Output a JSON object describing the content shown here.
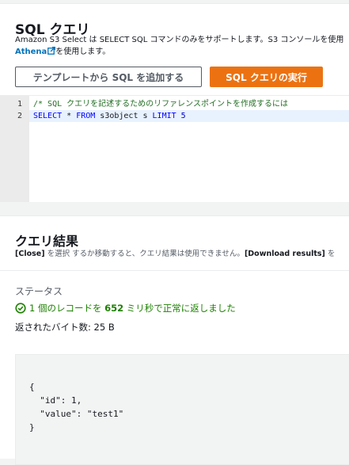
{
  "sql_panel": {
    "title": "SQL クエリ",
    "description_line1": "Amazon S3 Select は SELECT SQL コマンドのみをサポートします。S3 コンソールを使用",
    "athena_link": "Athena",
    "athena_link_icon": "external-link-icon",
    "description_line2_suffix": "を使用します。",
    "add_template_button": "テンプレートから SQL を追加する",
    "run_query_button": "SQL クエリの実行",
    "run_button_color": "#ec7211",
    "editor": {
      "line_numbers": [
        "1",
        "2"
      ],
      "line1_comment": "/* SQL クエリを記述するためのリファレンスポイントを作成するには",
      "line2": {
        "kw_select": "SELECT",
        "star": " * ",
        "kw_from": "FROM",
        "middle": " s3object s ",
        "kw_limit": "LIMIT",
        "space": " ",
        "limit_value": "5"
      }
    }
  },
  "results_panel": {
    "title": "クエリ結果",
    "desc_close": "[Close]",
    "desc_middle": " を選択 するか移動すると、クエリ結果は使用できません。",
    "desc_download": "[Download results]",
    "desc_tail": " を",
    "status_label": "ステータス",
    "status_icon": "check-circle-icon",
    "status_prefix": "1 個のレコードを ",
    "status_ms": "652",
    "status_suffix": " ミリ秒で正常に返しました",
    "status_color": "#1d8102",
    "bytes_label": "返されたバイト数: 25 B",
    "result_json": "{\n  \"id\": 1,\n  \"value\": \"test1\"\n}"
  }
}
